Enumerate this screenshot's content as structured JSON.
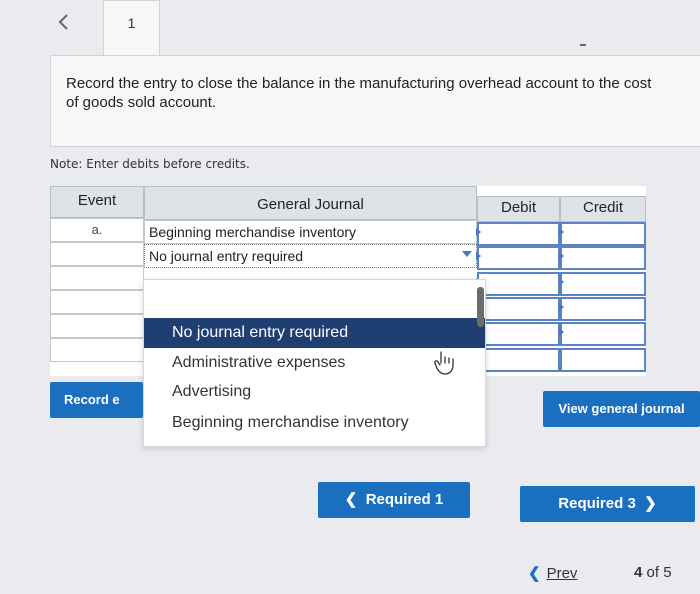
{
  "nav": {
    "back_icon": "chevron-left-icon",
    "tab_label": "1"
  },
  "question": {
    "text": "Record the entry to close the balance in the manufacturing overhead account to the cost of goods sold account."
  },
  "note": "Note: Enter debits before credits.",
  "journal": {
    "headers": {
      "event": "Event",
      "general_journal": "General Journal",
      "debit": "Debit",
      "credit": "Credit"
    },
    "rows": [
      {
        "event": "a.",
        "account": "Beginning merchandise inventory"
      },
      {
        "event": "",
        "account": "No journal entry required"
      }
    ]
  },
  "dropdown": {
    "options": [
      "No journal entry required",
      "Administrative expenses",
      "Advertising",
      "Beginning merchandise inventory"
    ],
    "selected": "No journal entry required"
  },
  "buttons": {
    "record": "Record e",
    "view_general_journal": "View general journal",
    "required1": "Required 1",
    "required3": "Required 3"
  },
  "pagination": {
    "prev": "Prev",
    "current": "4",
    "of": "of 5"
  },
  "colors": {
    "primary_button": "#1a6fc0",
    "selected_option": "#1f3f73",
    "header_bg": "#dfe3e8"
  }
}
